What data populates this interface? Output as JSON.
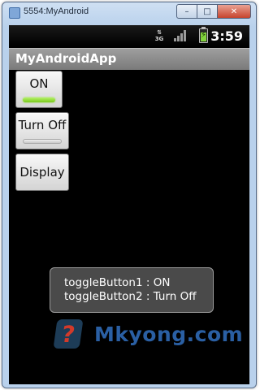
{
  "window": {
    "title": "5554:MyAndroid",
    "minimize_label": "–",
    "maximize_label": "□",
    "close_label": "✕"
  },
  "statusbar": {
    "network_up_down": "⇅",
    "network_type": "3G",
    "time": "3:59"
  },
  "app": {
    "title": "MyAndroidApp"
  },
  "buttons": {
    "toggle1_label": "ON",
    "toggle1_state": "on",
    "toggle2_label": "Turn Off",
    "toggle2_state": "off",
    "display_label": "Display"
  },
  "toast": {
    "line1": "toggleButton1 : ON",
    "line2": "toggleButton2 : Turn Off"
  },
  "watermark": {
    "text": "Mkyong.com"
  },
  "colors": {
    "toggle_on": "#8ad62f",
    "window_frame": "#b9d1ec",
    "close_button": "#c7442d"
  },
  "icons": [
    "app-icon",
    "network-3g-icon",
    "signal-strength-icon",
    "battery-charging-icon",
    "watermark-logo-icon"
  ]
}
